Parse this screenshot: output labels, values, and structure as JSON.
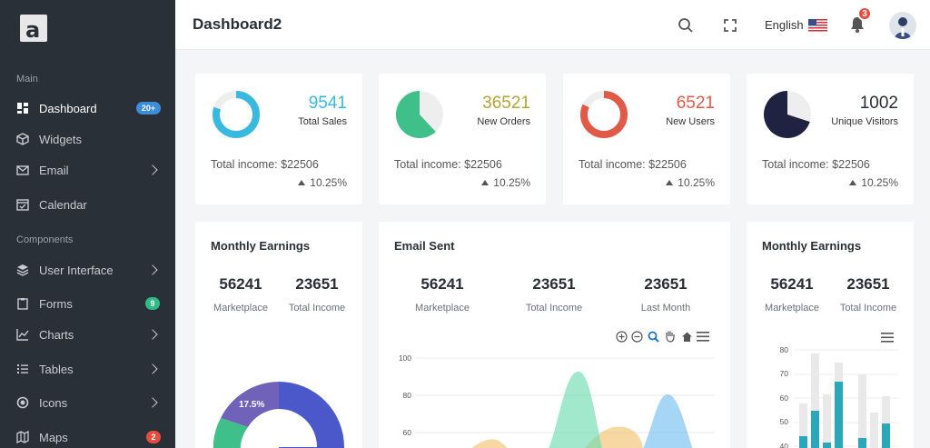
{
  "sidebar": {
    "logo": "a",
    "sections": {
      "main": "Main",
      "components": "Components"
    },
    "items": [
      {
        "label": "Dashboard",
        "icon": "dashboard-icon",
        "badge": "20+",
        "badge_color": "#3d8ed8"
      },
      {
        "label": "Widgets",
        "icon": "cube-icon"
      },
      {
        "label": "Email",
        "icon": "envelope-icon"
      },
      {
        "label": "Calendar",
        "icon": "calendar-icon"
      },
      {
        "label": "User Interface",
        "icon": "layers-icon"
      },
      {
        "label": "Forms",
        "icon": "clipboard-icon",
        "badge": "9",
        "badge_color": "#2ebb87"
      },
      {
        "label": "Charts",
        "icon": "line-chart-icon"
      },
      {
        "label": "Tables",
        "icon": "list-icon"
      },
      {
        "label": "Icons",
        "icon": "record-icon"
      },
      {
        "label": "Maps",
        "icon": "map-icon",
        "badge": "2",
        "badge_color": "#e74c3c"
      }
    ]
  },
  "header": {
    "title": "Dashboard2",
    "language": "English",
    "notification_count": "3"
  },
  "stats": [
    {
      "value": "9541",
      "label": "Total Sales",
      "income": "Total income: $22506",
      "change": "10.25%",
      "color": "#3ab9e0",
      "fill": 0.8
    },
    {
      "value": "36521",
      "label": "New Orders",
      "income": "Total income: $22506",
      "change": "10.25%",
      "color": "#3fbf8a",
      "fill": 0.62
    },
    {
      "value": "6521",
      "label": "New Users",
      "income": "Total income: $22506",
      "change": "10.25%",
      "color": "#e05a47",
      "fill": 0.82
    },
    {
      "value": "1002",
      "label": "Unique Visitors",
      "income": "Total income: $22506",
      "change": "10.25%",
      "color": "#1f2240",
      "fill": 0.7
    }
  ],
  "panels": {
    "monthly_left": {
      "title": "Monthly Earnings",
      "metrics": [
        {
          "value": "56241",
          "label": "Marketplace"
        },
        {
          "value": "23651",
          "label": "Total Income"
        }
      ],
      "donut_label": "17.5%"
    },
    "email": {
      "title": "Email Sent",
      "metrics": [
        {
          "value": "56241",
          "label": "Marketplace"
        },
        {
          "value": "23651",
          "label": "Total Income"
        },
        {
          "value": "23651",
          "label": "Last Month"
        }
      ],
      "y_ticks": [
        "100",
        "80",
        "60"
      ]
    },
    "monthly_right": {
      "title": "Monthly Earnings",
      "metrics": [
        {
          "value": "56241",
          "label": "Marketplace"
        },
        {
          "value": "23651",
          "label": "Total Income"
        }
      ],
      "y_ticks": [
        "80",
        "70",
        "60",
        "50",
        "40"
      ]
    }
  },
  "colors": {
    "sidebar_bg": "#2a3038",
    "accent_blue": "#3d8ed8",
    "teal": "#2aa7b8"
  }
}
